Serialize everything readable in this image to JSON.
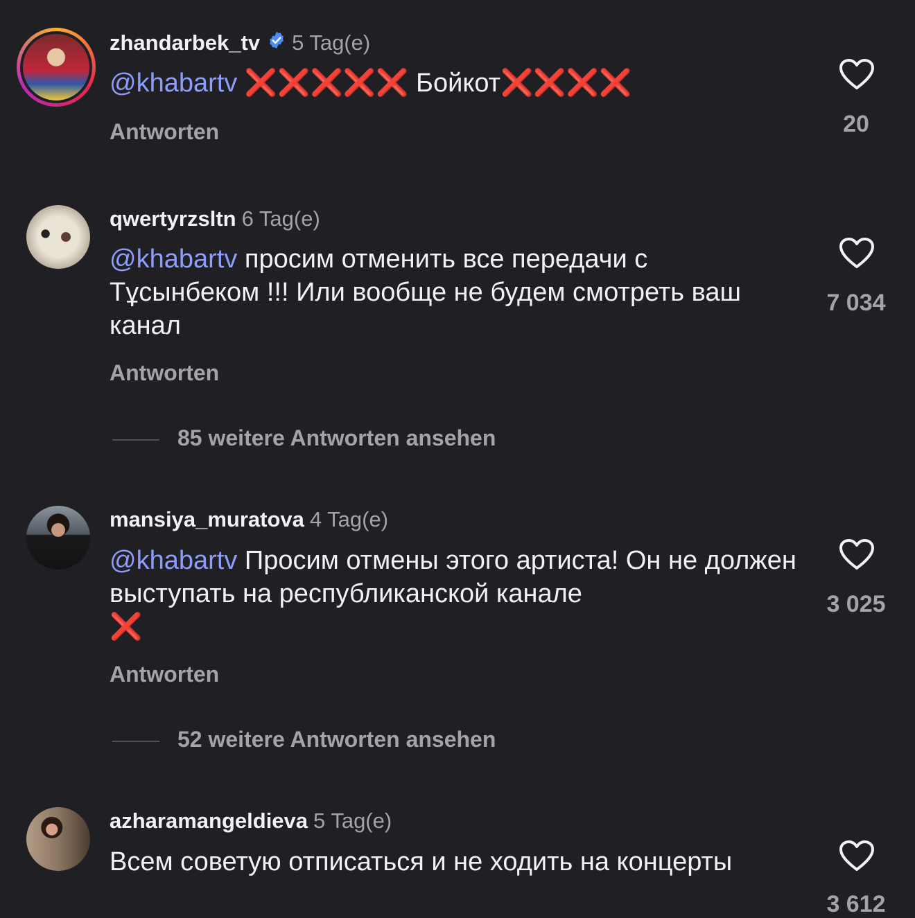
{
  "comments": [
    {
      "username": "zhandarbek_tv",
      "verified": true,
      "time": "5 Tag(e)",
      "mention": "@khabartv",
      "text_a": " ❌❌❌❌❌ ",
      "text_b": "Бойкот",
      "text_c": "❌❌❌❌",
      "reply": "Antworten",
      "likes": "20"
    },
    {
      "username": "qwertyrzsltn",
      "time": "6 Tag(e)",
      "mention": "@khabartv",
      "text": " просим отменить все передачи с Тұсынбеком !!! Или вообще не будем смотреть ваш канал",
      "reply": "Antworten",
      "likes": "7 034",
      "more_replies": "85 weitere Antworten ansehen"
    },
    {
      "username": "mansiya_muratova",
      "time": "4 Tag(e)",
      "mention": "@khabartv",
      "text": " Просим отмены этого артиста! Он не должен выступать на республиканской канале",
      "text_x": "❌",
      "reply": "Antworten",
      "likes": "3 025",
      "more_replies": "52 weitere Antworten ansehen"
    },
    {
      "username": "azharamangeldieva",
      "time": "5 Tag(e)",
      "text": "Всем советую отписаться и не ходить на концерты",
      "likes": "3 612"
    }
  ],
  "icons": {
    "like": "heart-outline-icon",
    "verified": "verified-badge-icon"
  },
  "colors": {
    "background": "#1f1f24",
    "mention": "#8e9dfa",
    "muted": "#a3a4ab",
    "verified": "#4b8cf5",
    "xmark": "#e1301e"
  }
}
